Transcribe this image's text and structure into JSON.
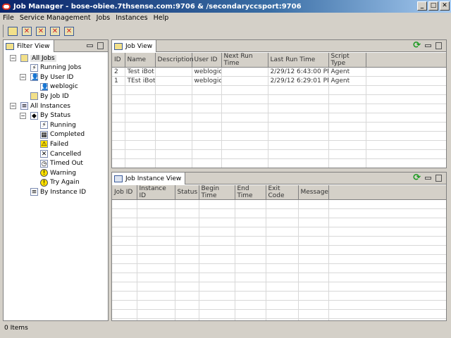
{
  "window": {
    "title": "Job Manager - bose-obiee.7thsense.com:9706 & /secondaryccsport:9706",
    "min": "_",
    "max": "□",
    "close": "✕"
  },
  "menu": [
    "File",
    "Service Management",
    "Jobs",
    "Instances",
    "Help"
  ],
  "toolbar": [
    "add-job-icon",
    "enable-job-icon",
    "delete-job-icon",
    "remove-instance-icon",
    "cancel-icon"
  ],
  "filter_view": {
    "tab": "Filter View",
    "tree": [
      {
        "label": "All Jobs",
        "level": 0,
        "exp": "−",
        "icon": "jobs-icon",
        "selected": true
      },
      {
        "label": "Running Jobs",
        "level": 1,
        "icon": "running-icon"
      },
      {
        "label": "By User ID",
        "level": 1,
        "exp": "−",
        "icon": "user-icon"
      },
      {
        "label": "weblogic",
        "level": 2,
        "icon": "user-icon"
      },
      {
        "label": "By Job ID",
        "level": 1,
        "icon": "jobs-icon"
      },
      {
        "label": "All Instances",
        "level": 0,
        "exp": "−",
        "icon": "instances-icon"
      },
      {
        "label": "By Status",
        "level": 1,
        "exp": "−",
        "icon": "status-icon"
      },
      {
        "label": "Running",
        "level": 2,
        "icon": "running-icon"
      },
      {
        "label": "Completed",
        "level": 2,
        "icon": "completed-icon"
      },
      {
        "label": "Failed",
        "level": 2,
        "icon": "warning-icon"
      },
      {
        "label": "Cancelled",
        "level": 2,
        "icon": "cancelled-icon"
      },
      {
        "label": "Timed Out",
        "level": 2,
        "icon": "clock-icon"
      },
      {
        "label": "Warning",
        "level": 2,
        "icon": "info-icon"
      },
      {
        "label": "Try Again",
        "level": 2,
        "icon": "info-icon"
      },
      {
        "label": "By Instance ID",
        "level": 1,
        "icon": "document-icon"
      }
    ]
  },
  "job_view": {
    "tab": "Job View",
    "columns": [
      "ID",
      "Name",
      "Description",
      "User ID",
      "Next Run Time",
      "Last Run Time",
      "Script Type"
    ],
    "rows": [
      [
        "2",
        "Test iBot",
        "",
        "weblogic",
        "",
        "2/29/12 6:43:00 PM",
        "Agent"
      ],
      [
        "1",
        "TEst iBot",
        "",
        "weblogic",
        "",
        "2/29/12 6:29:01 PM",
        "Agent"
      ]
    ]
  },
  "instance_view": {
    "tab": "Job Instance View",
    "columns": [
      "Job ID",
      "Instance ID",
      "Status",
      "Begin Time",
      "End Time",
      "Exit Code",
      "Message"
    ],
    "rows": []
  },
  "status_bar": "0 Items"
}
